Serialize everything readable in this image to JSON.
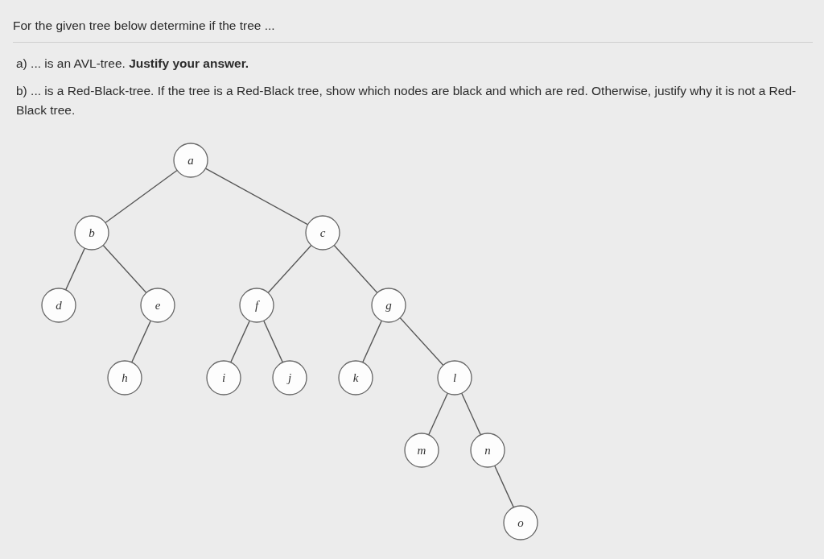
{
  "question": {
    "intro": "For the given tree below determine if the tree ...",
    "parts": [
      "a) ... is an AVL-tree. **Justify your answer.**",
      "b) ... is a Red-Black-tree. If the tree is a Red-Black tree, show which nodes are black and which are red. Otherwise, justify why it is not a Red-Black tree."
    ]
  },
  "tree": {
    "label": "a",
    "left": {
      "label": "b",
      "left": {
        "label": "d"
      },
      "right": {
        "label": "e",
        "left": {
          "label": "h"
        }
      }
    },
    "right": {
      "label": "c",
      "left": {
        "label": "f",
        "left": {
          "label": "i"
        },
        "right": {
          "label": "j"
        }
      },
      "right": {
        "label": "g",
        "left": {
          "label": "k"
        },
        "right": {
          "label": "l",
          "left": {
            "label": "m"
          },
          "right": {
            "label": "n",
            "right": {
              "label": "o"
            }
          }
        }
      }
    }
  }
}
